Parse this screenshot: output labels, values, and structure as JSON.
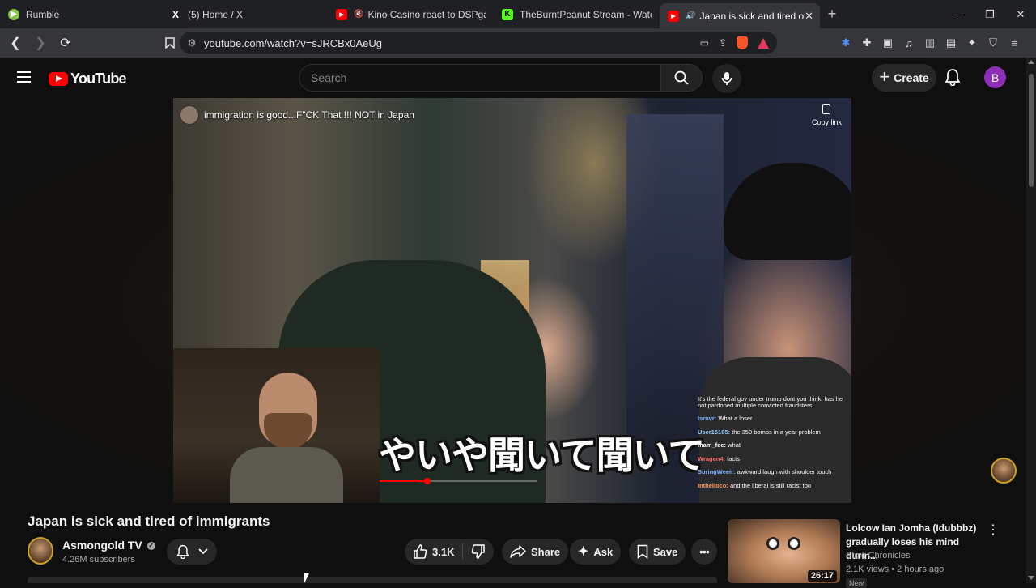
{
  "browser": {
    "tabs": [
      {
        "title": "Rumble",
        "icon": "rumble-icon"
      },
      {
        "title": "(5) Home / X",
        "icon": "x-icon"
      },
      {
        "title": "Kino Casino react to DSPgaming's",
        "icon": "youtube-icon"
      },
      {
        "title": "TheBurntPeanut Stream - Watch Live",
        "icon": "kick-icon"
      },
      {
        "title": "Japan is sick and tired of imm",
        "icon": "youtube-icon",
        "active": true
      }
    ],
    "url": "youtube.com/watch?v=sJRCBx0AeUg",
    "window_controls": [
      "minimize",
      "restore",
      "close"
    ]
  },
  "youtube": {
    "logo_text": "YouTube",
    "search_placeholder": "Search",
    "create_label": "Create",
    "avatar_letter": "B",
    "accent": "#ff0000"
  },
  "player": {
    "overlay_title": "immigration is good...F\"CK That !!! NOT in Japan",
    "copy_link_label": "Copy link",
    "subtitle": "やいや聞いて聞いて",
    "progress": 0.3,
    "chat": [
      {
        "user": "",
        "text": "It's the federal gov under trump dont you think. has he not pardoned multiple convicted fraudsters"
      },
      {
        "user": "Isrnvr:",
        "text": "What a loser"
      },
      {
        "user": "User15165:",
        "text": "the 350 bombs in a year problem"
      },
      {
        "user": "mam_fee:",
        "text": "what"
      },
      {
        "user": "Wragen4:",
        "text": "facts"
      },
      {
        "user": "SuringWeeir:",
        "text": "awkward laugh with shoulder touch"
      },
      {
        "user": "Inthelloco:",
        "text": "and the liberal is still racist too"
      }
    ]
  },
  "video": {
    "title": "Japan is sick and tired of immigrants",
    "channel": "Asmongold TV",
    "subscribers": "4.26M subscribers",
    "likes": "3.1K",
    "share_label": "Share",
    "ask_label": "Ask",
    "save_label": "Save"
  },
  "recommended": [
    {
      "title": "Lolcow Ian Jomha (Idubbbz) gradually loses his mind durin...",
      "channel": "Stoic Chronicles",
      "meta": "2.1K views • 2 hours ago",
      "duration": "26:17",
      "badge": "New"
    }
  ]
}
